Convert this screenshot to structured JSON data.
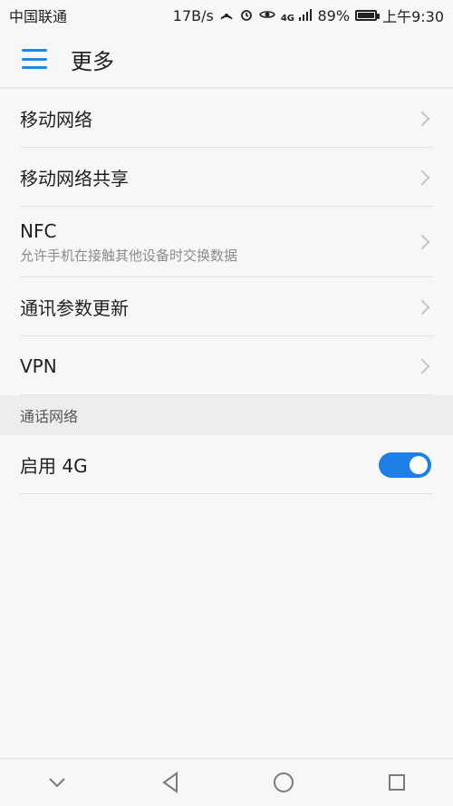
{
  "status_bar": {
    "carrier": "中国联通",
    "speed": "17B/s",
    "network": "4G",
    "battery": "89%",
    "battery_level": 0.89,
    "time": "上午9:30"
  },
  "header": {
    "title": "更多",
    "menu_icon": "hamburger-icon"
  },
  "items": [
    {
      "title": "移动网络"
    },
    {
      "title": "移动网络共享"
    },
    {
      "title": "NFC",
      "subtitle": "允许手机在接触其他设备时交换数据"
    },
    {
      "title": "通讯参数更新"
    },
    {
      "title": "VPN"
    }
  ],
  "call_section": {
    "header": "通话网络",
    "toggle_label": "启用 4G",
    "toggle_on": true
  },
  "nav_bar": {
    "buttons": [
      "chevron-down-icon",
      "back-triangle-icon",
      "home-circle-icon",
      "recent-square-icon"
    ]
  },
  "colors": {
    "accent": "#1e88e5",
    "toggle": "#1e7fe6",
    "background": "#f7f7f7"
  }
}
